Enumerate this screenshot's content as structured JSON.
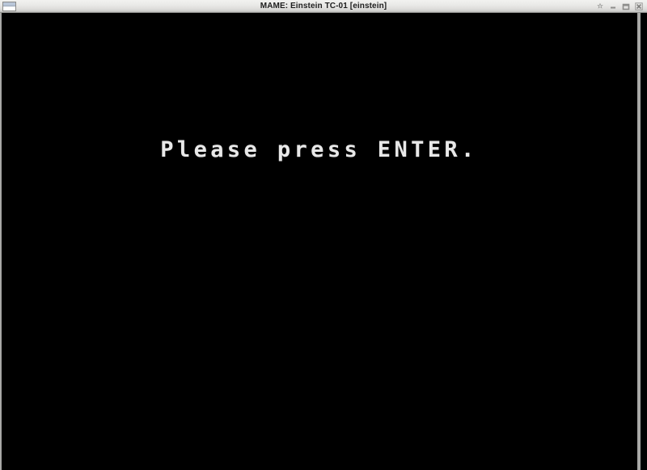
{
  "window": {
    "title": "MAME: Einstein TC-01 [einstein]",
    "menu_icon": "window-menu-icon",
    "controls": [
      {
        "name": "keep-above-button",
        "icon": "pin-icon",
        "label": "Keep Above"
      },
      {
        "name": "minimize-button",
        "icon": "minimize-icon",
        "label": "Minimize"
      },
      {
        "name": "maximize-button",
        "icon": "maximize-icon",
        "label": "Maximize"
      },
      {
        "name": "close-button",
        "icon": "close-icon",
        "label": "Close"
      }
    ]
  },
  "screen": {
    "background_color": "#000000",
    "text_color": "#e8e8e8",
    "message": "Please press ENTER."
  },
  "colors": {
    "titlebar_top": "#f2f2f0",
    "titlebar_bottom": "#b6b6b4",
    "titlebar_border": "#8f8f8d",
    "frame_border": "#a9a9a7",
    "screen_background": "#000000",
    "screen_foreground": "#e8e8e8",
    "title_text": "#1d1d1d"
  }
}
